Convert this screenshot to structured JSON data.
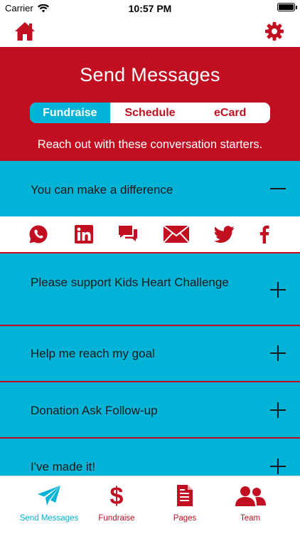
{
  "status_bar": {
    "carrier": "Carrier",
    "time": "10:57 PM"
  },
  "nav": {
    "home_icon": "home-icon",
    "settings_icon": "gear-icon"
  },
  "hero": {
    "title": "Send Messages",
    "tabs": [
      {
        "label": "Fundraise",
        "active": true
      },
      {
        "label": "Schedule",
        "active": false
      },
      {
        "label": "eCard",
        "active": false
      }
    ],
    "subtitle": "Reach out with these conversation starters."
  },
  "messages": [
    {
      "label": "You can make a difference",
      "expanded": true
    },
    {
      "label": "Please support Kids Heart Challenge",
      "expanded": false
    },
    {
      "label": "Help me reach my goal",
      "expanded": false
    },
    {
      "label": "Donation Ask Follow-up",
      "expanded": false
    },
    {
      "label": "I've made it!",
      "expanded": false
    }
  ],
  "share_icons": [
    "whatsapp-icon",
    "linkedin-icon",
    "chat-icon",
    "email-icon",
    "twitter-icon",
    "facebook-icon"
  ],
  "tab_bar": [
    {
      "label": "Send Messages",
      "icon": "paper-plane-icon",
      "active": true
    },
    {
      "label": "Fundraise",
      "icon": "dollar-icon",
      "active": false
    },
    {
      "label": "Pages",
      "icon": "document-icon",
      "active": false
    },
    {
      "label": "Team",
      "icon": "team-icon",
      "active": false
    }
  ],
  "colors": {
    "brand_red": "#c10e21",
    "accent_blue": "#00b3d7"
  }
}
